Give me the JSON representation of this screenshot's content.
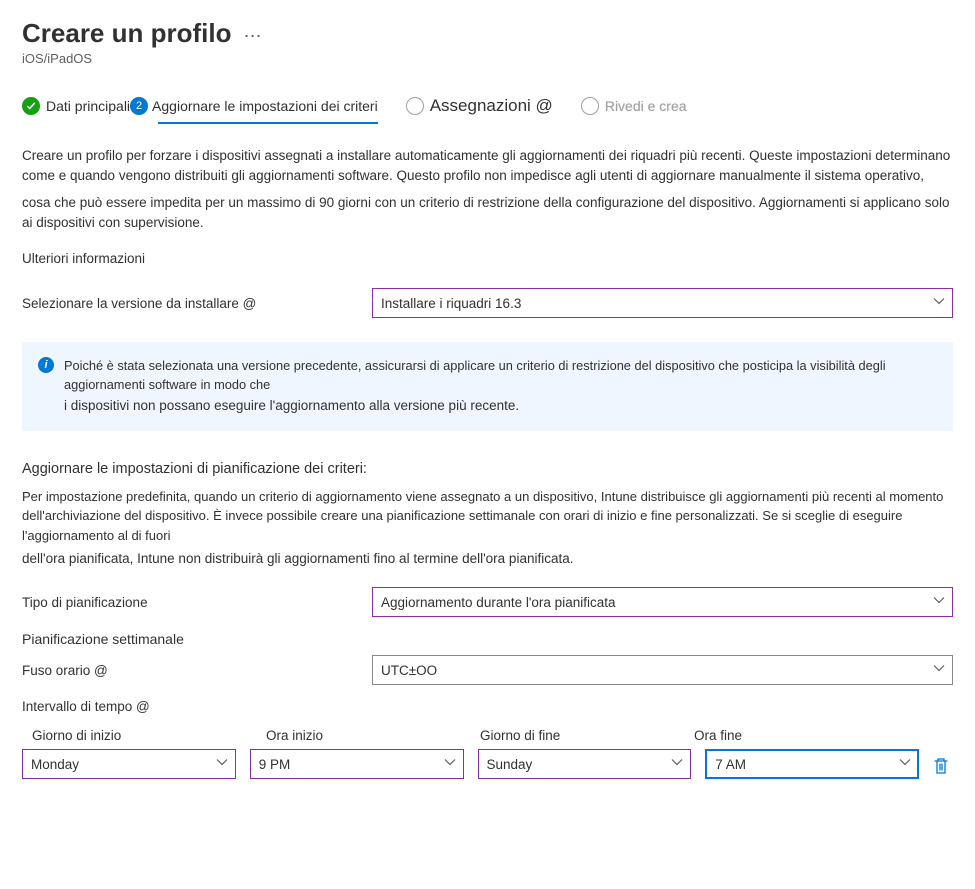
{
  "header": {
    "title": "Creare un profilo",
    "subtitle": "iOS/iPadOS"
  },
  "tabs": {
    "basics": "Dati principali",
    "update": "Aggiornare le impostazioni dei criteri",
    "assign": "Assegnazioni @",
    "review": "Rivedi e crea"
  },
  "intro": {
    "line1": "Creare un profilo per forzare i dispositivi assegnati a installare automaticamente gli aggiornamenti dei riquadri più recenti. Queste impostazioni determinano come e quando vengono distribuiti gli aggiornamenti software. Questo profilo non impedisce agli utenti di aggiornare manualmente il sistema operativo,",
    "line2": "cosa che può essere impedita per un massimo di 90 giorni con un criterio di restrizione della configurazione del dispositivo. Aggiornamenti si applicano solo ai dispositivi con supervisione.",
    "more": "Ulteriori informazioni"
  },
  "version": {
    "label": "Selezionare la versione da installare @",
    "value": "Installare i riquadri 16.3"
  },
  "infobox": {
    "text1": "Poiché è stata selezionata una versione precedente, assicurarsi di applicare un criterio di restrizione del dispositivo che posticipa la visibilità degli aggiornamenti software in modo che",
    "text2": "i dispositivi non possano eseguire l'aggiornamento alla versione più recente."
  },
  "schedule": {
    "heading": "Aggiornare le impostazioni di pianificazione dei criteri:",
    "desc1": "Per impostazione predefinita, quando un criterio di aggiornamento viene assegnato a un dispositivo, Intune distribuisce gli aggiornamenti più recenti al momento dell'archiviazione del dispositivo. È invece possibile creare una pianificazione settimanale con orari di inizio e fine personalizzati. Se si sceglie di eseguire l'aggiornamento al di fuori",
    "desc2": "dell'ora pianificata, Intune non distribuirà gli aggiornamenti fino al termine dell'ora pianificata.",
    "type_label": "Tipo di pianificazione",
    "type_value": "Aggiornamento durante l'ora pianificata",
    "weekly_label": "Pianificazione settimanale",
    "tz_label": "Fuso orario @",
    "tz_value": "UTC±OO",
    "window_label": "Intervallo di tempo @"
  },
  "window": {
    "start_day_label": "Giorno di inizio",
    "start_time_label": "Ora inizio",
    "end_day_label": "Giorno di fine",
    "end_time_label": "Ora fine",
    "start_day": "Monday",
    "start_time": "9 PM",
    "end_day": "Sunday",
    "end_time": "7 AM"
  }
}
